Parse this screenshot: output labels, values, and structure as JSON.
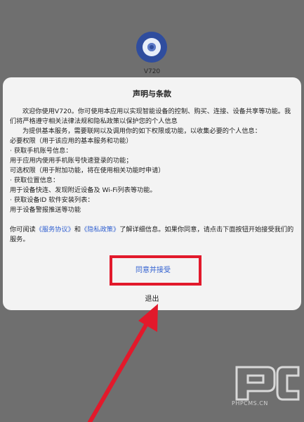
{
  "app": {
    "name": "V720",
    "logo_icon": "camera-icon"
  },
  "dialog": {
    "title": "声明与条款",
    "body": [
      "欢迎你使用V720。你可使用本应用以实现智能设备的控制、购买、连接、设备共享等功能。我们将严格遵守相关法律法规和隐私政策以保护您的个人信息",
      "为提供基本服务，需要联网以及调用你的如下权限或功能，以收集必要的个人信息：",
      "必要权限（用于该应用的基本服务和功能）",
      "· 获取手机账号信息：",
      "用于应用内使用手机账号快速登录的功能；",
      "可选权限（用于附加功能，将在使用相关功能时申请）",
      "· 获取位置信息：",
      "用于设备快连、发现附近设备及 Wi-Fi列表等功能。",
      "· 获取设备ID 软件安装列表：",
      "用于设备警报推送等功能"
    ],
    "closing_prefix": "你可阅读",
    "service_agreement_link": "《服务协议》",
    "and_text": "和",
    "privacy_policy_link": "《隐私政策》",
    "closing_suffix": "了解详细信息。如果你同意，请点击下面按钮开始接受我们的服务。",
    "agree_label": "同意并接受",
    "exit_label": "退出"
  },
  "watermark": {
    "text": "PHPCMS.CN"
  },
  "colors": {
    "accent": "#2f5fd0",
    "annotation_red": "#e2192b",
    "overlay": "#6f6f6f"
  }
}
